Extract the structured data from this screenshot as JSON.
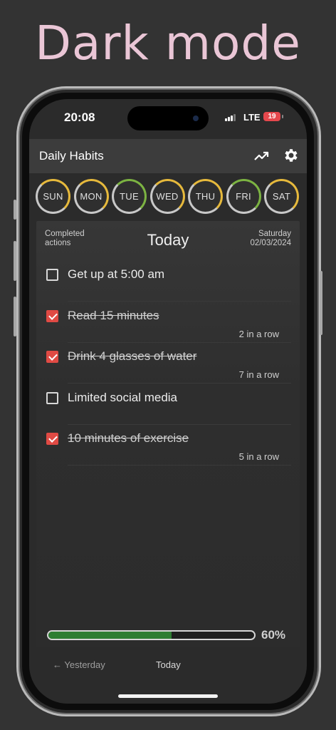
{
  "banner": "Dark mode",
  "status_bar": {
    "time": "20:08",
    "network": "LTE",
    "battery": "19"
  },
  "app": {
    "title": "Daily Habits",
    "icons": [
      "trend-up-icon",
      "gear-icon"
    ]
  },
  "days": [
    {
      "label": "SUN",
      "ring_color": "#e6b93c"
    },
    {
      "label": "MON",
      "ring_color": "#e6b93c"
    },
    {
      "label": "TUE",
      "ring_color": "#7cb342"
    },
    {
      "label": "WED",
      "ring_color": "#e6b93c"
    },
    {
      "label": "THU",
      "ring_color": "#e6b93c"
    },
    {
      "label": "FRI",
      "ring_color": "#7cb342"
    },
    {
      "label": "SAT",
      "ring_color": "#e6b93c"
    }
  ],
  "header": {
    "completed_label": "Completed actions",
    "title": "Today",
    "weekday": "Saturday",
    "date": "02/03/2024"
  },
  "habits": [
    {
      "name": "Get up at 5:00 am",
      "checked": false,
      "streak": ""
    },
    {
      "name": "Read 15 minutes",
      "checked": true,
      "streak": "2 in a row"
    },
    {
      "name": "Drink 4 glasses of water",
      "checked": true,
      "streak": "7 in a row"
    },
    {
      "name": "Limited social media",
      "checked": false,
      "streak": ""
    },
    {
      "name": "10 minutes of exercise",
      "checked": true,
      "streak": "5 in a row"
    }
  ],
  "progress": {
    "value": 0.6,
    "label": "60%"
  },
  "nav": {
    "prev": "← Yesterday",
    "current": "Today"
  },
  "colors": {
    "accent_red": "#e04a44",
    "progress_green": "#2e7d32"
  }
}
